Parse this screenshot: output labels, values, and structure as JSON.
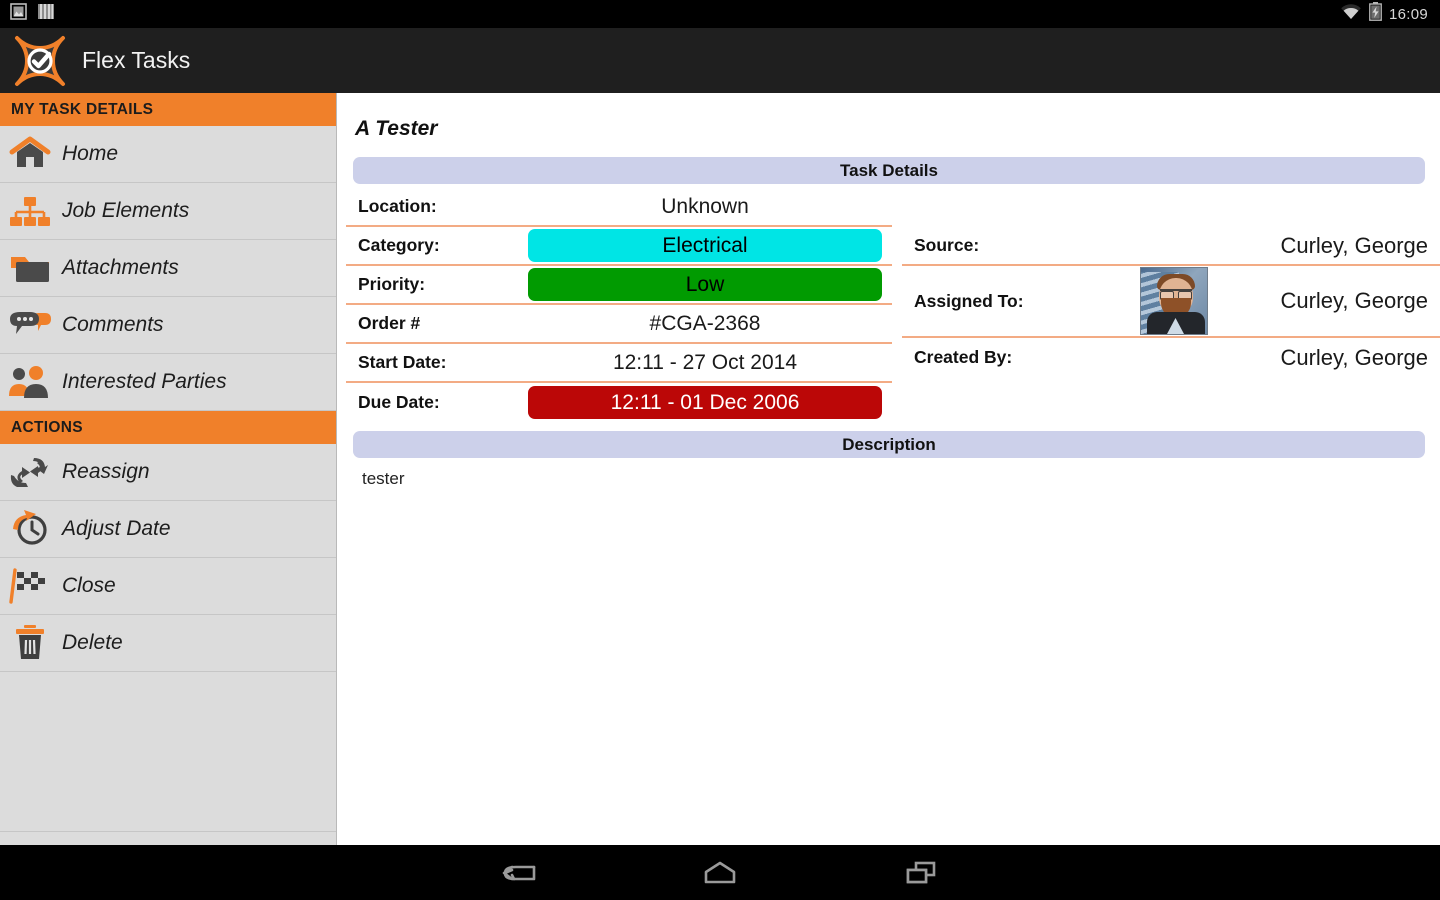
{
  "statusbar": {
    "left_icons": [
      "screenshot-icon",
      "bars-icon"
    ],
    "right_icons": [
      "wifi-icon",
      "battery-charging-icon"
    ],
    "clock": "16:09"
  },
  "actionbar": {
    "logo_icon": "flex-tasks-logo-icon",
    "title": "Flex Tasks"
  },
  "sidebar": {
    "sections": [
      {
        "header": "MY TASK DETAILS",
        "items": [
          {
            "label": "Home",
            "icon": "home-icon"
          },
          {
            "label": "Job Elements",
            "icon": "hierarchy-icon"
          },
          {
            "label": "Attachments",
            "icon": "folder-icon"
          },
          {
            "label": "Comments",
            "icon": "chat-bubbles-icon"
          },
          {
            "label": "Interested Parties",
            "icon": "people-icon"
          }
        ]
      },
      {
        "header": "ACTIONS",
        "items": [
          {
            "label": "Reassign",
            "icon": "reassign-arrows-icon"
          },
          {
            "label": "Adjust Date",
            "icon": "clock-arrow-icon"
          },
          {
            "label": "Close",
            "icon": "checkered-flag-icon"
          },
          {
            "label": "Delete",
            "icon": "trash-icon"
          }
        ]
      }
    ]
  },
  "main": {
    "page_title": "A Tester",
    "task_details_header": "Task Details",
    "description_header": "Description",
    "description_text": "tester",
    "left_rows": [
      {
        "label": "Location:",
        "value": "Unknown",
        "badge": false
      },
      {
        "label": "Category:",
        "value": "Electrical",
        "badge": true,
        "badge_color": "#00e5e5",
        "badge_text_color": "#000000"
      },
      {
        "label": "Priority:",
        "value": "Low",
        "badge": true,
        "badge_color": "#019b01",
        "badge_text_color": "#000000"
      },
      {
        "label": "Order #",
        "value": "#CGA-2368",
        "badge": false
      },
      {
        "label": "Start Date:",
        "value": "12:11 - 27 Oct 2014",
        "badge": false
      },
      {
        "label": "Due Date:",
        "value": "12:11 - 01 Dec 2006",
        "badge": true,
        "badge_color": "#bb0707",
        "badge_text_color": "#ffffff"
      }
    ],
    "right_rows": [
      {
        "label": "Source:",
        "value": "Curley, George",
        "avatar": false
      },
      {
        "label": "Assigned To:",
        "value": "Curley, George",
        "avatar": true
      },
      {
        "label": "Created By:",
        "value": "Curley, George",
        "avatar": false
      }
    ]
  },
  "navbar": {
    "buttons": [
      "back-icon",
      "home-icon",
      "recents-icon"
    ]
  },
  "colors": {
    "accent_orange": "#f0802a",
    "sidebar_bg": "#dcdcdc",
    "section_bar": "#ccd0ea",
    "divider": "#f3ab84",
    "actionbar_bg": "#1f1f1f"
  }
}
